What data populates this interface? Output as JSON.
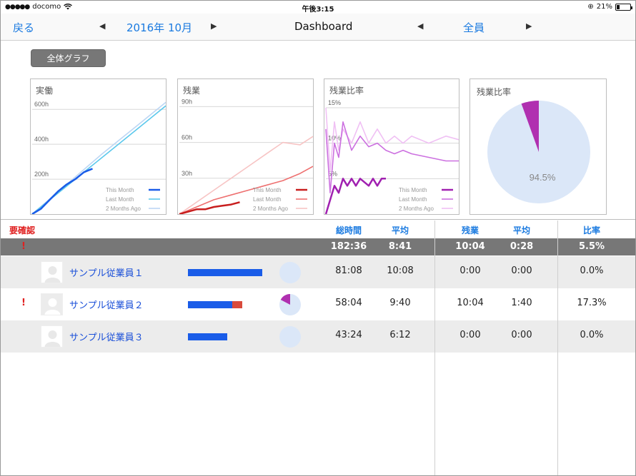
{
  "statusbar": {
    "carrier": "docomo",
    "time": "午後3:15",
    "battery": "21%"
  },
  "nav": {
    "back": "戻る",
    "month": "2016年 10月",
    "title": "Dashboard",
    "filter": "全員",
    "prev_icon": "◀",
    "next_icon": "▶"
  },
  "all_graph_button": "全体グラフ",
  "colors": {
    "accent": "#1a7ae0",
    "alert": "#e02020",
    "bar_work": "#1a5ce8",
    "bar_overtime": "#d94a3c",
    "pie_fill": "#dbe7f8",
    "pie_slice": "#b030b0"
  },
  "panels": {
    "actual": {
      "title": "実働",
      "ticks": [
        "600h",
        "400h",
        "200h"
      ]
    },
    "overtime": {
      "title": "残業",
      "ticks": [
        "90h",
        "60h",
        "30h"
      ]
    },
    "overtime_ratio": {
      "title": "残業比率",
      "ticks": [
        "15%",
        "10%",
        "5%"
      ]
    },
    "ratio_pie": {
      "title": "残業比率"
    },
    "legend": [
      "This Month",
      "Last Month",
      "2 Months Ago"
    ]
  },
  "chart_data": [
    {
      "type": "line",
      "title": "実働",
      "ylim": [
        0,
        650
      ],
      "yticks": [
        200,
        400,
        600
      ],
      "ytick_labels": [
        "200h",
        "400h",
        "600h"
      ],
      "series": [
        {
          "name": "This Month",
          "x": [
            0,
            2,
            4,
            6,
            8,
            10,
            12,
            14
          ],
          "values": [
            0,
            30,
            80,
            130,
            170,
            200,
            240,
            260
          ]
        },
        {
          "name": "Last Month",
          "x": [
            0,
            4,
            8,
            12,
            16,
            20,
            24,
            28,
            31
          ],
          "values": [
            0,
            80,
            160,
            240,
            320,
            400,
            480,
            560,
            620
          ]
        },
        {
          "name": "2 Months Ago",
          "x": [
            0,
            4,
            8,
            12,
            16,
            20,
            24,
            28,
            31
          ],
          "values": [
            0,
            85,
            170,
            255,
            340,
            420,
            500,
            580,
            640
          ]
        }
      ]
    },
    {
      "type": "line",
      "title": "残業",
      "ylim": [
        0,
        95
      ],
      "yticks": [
        30,
        60,
        90
      ],
      "ytick_labels": [
        "30h",
        "60h",
        "90h"
      ],
      "series": [
        {
          "name": "This Month",
          "x": [
            0,
            2,
            4,
            6,
            8,
            10,
            12,
            14
          ],
          "values": [
            0,
            2,
            4,
            4,
            6,
            7,
            8,
            10
          ]
        },
        {
          "name": "Last Month",
          "x": [
            0,
            4,
            8,
            12,
            16,
            20,
            24,
            28,
            31
          ],
          "values": [
            0,
            6,
            12,
            16,
            20,
            24,
            28,
            34,
            40
          ]
        },
        {
          "name": "2 Months Ago",
          "x": [
            0,
            4,
            8,
            12,
            16,
            20,
            24,
            28,
            31
          ],
          "values": [
            0,
            10,
            20,
            30,
            40,
            50,
            60,
            58,
            65
          ]
        }
      ]
    },
    {
      "type": "line",
      "title": "残業比率",
      "ylim": [
        0,
        16
      ],
      "yticks": [
        5,
        10,
        15
      ],
      "ytick_labels": [
        "5%",
        "10%",
        "15%"
      ],
      "series": [
        {
          "name": "This Month",
          "x": [
            0,
            1,
            2,
            3,
            4,
            5,
            6,
            7,
            8,
            9,
            10,
            11,
            12,
            13,
            14
          ],
          "values": [
            0,
            2,
            4,
            3,
            5,
            4,
            5,
            4,
            5,
            4.5,
            4,
            5,
            4,
            5,
            5
          ]
        },
        {
          "name": "Last Month",
          "x": [
            0,
            1,
            2,
            3,
            4,
            6,
            8,
            10,
            12,
            14,
            16,
            18,
            20,
            24,
            28,
            31
          ],
          "values": [
            12,
            3,
            10,
            8,
            13,
            9,
            11,
            9.5,
            10,
            9,
            8.5,
            9,
            8.5,
            8,
            7.5,
            7.5
          ]
        },
        {
          "name": "2 Months Ago",
          "x": [
            0,
            1,
            2,
            3,
            4,
            6,
            8,
            10,
            12,
            14,
            16,
            18,
            20,
            24,
            28,
            31
          ],
          "values": [
            15,
            6,
            13,
            9,
            12,
            10,
            13,
            10,
            12,
            10,
            11,
            10,
            11,
            10,
            11,
            10.5
          ]
        }
      ]
    },
    {
      "type": "pie",
      "title": "残業比率",
      "slices": [
        {
          "label": "94.5%",
          "value": 94.5
        },
        {
          "label": "",
          "value": 5.5
        }
      ]
    }
  ],
  "table": {
    "confirm_header": "要確認",
    "headers": {
      "total": "総時間",
      "avg": "平均",
      "overtime": "残業",
      "ot_avg": "平均",
      "ratio": "比率"
    },
    "summary": {
      "flag": "!",
      "total": "182:36",
      "avg": "8:41",
      "overtime": "10:04",
      "ot_avg": "0:28",
      "ratio": "5.5%"
    },
    "rows": [
      {
        "flag": "",
        "name": "サンプル従業員１",
        "total": "81:08",
        "avg": "10:08",
        "overtime": "0:00",
        "ot_avg": "0:00",
        "ratio": "0.0%",
        "work": 0.45,
        "ot": 0.0,
        "pie_ratio": 0.0
      },
      {
        "flag": "!",
        "name": "サンプル従業員２",
        "total": "58:04",
        "avg": "9:40",
        "overtime": "10:04",
        "ot_avg": "1:40",
        "ratio": "17.3%",
        "work": 0.27,
        "ot": 0.06,
        "pie_ratio": 0.173
      },
      {
        "flag": "",
        "name": "サンプル従業員３",
        "total": "43:24",
        "avg": "6:12",
        "overtime": "0:00",
        "ot_avg": "0:00",
        "ratio": "0.0%",
        "work": 0.24,
        "ot": 0.0,
        "pie_ratio": 0.0
      }
    ]
  }
}
